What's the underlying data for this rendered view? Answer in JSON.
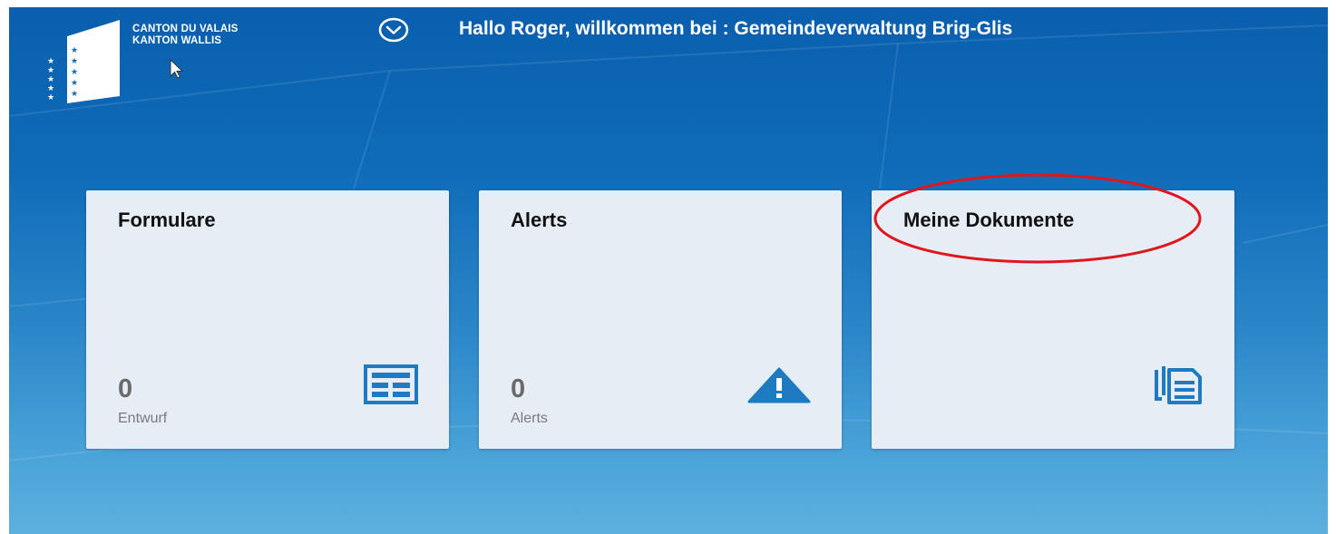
{
  "header": {
    "org_line1": "CANTON DU VALAIS",
    "org_line2": "KANTON WALLIS",
    "greeting": "Hallo Roger, willkommen bei : Gemeindeverwaltung Brig-Glis"
  },
  "tiles": [
    {
      "title": "Formulare",
      "number": "0",
      "unit": "Entwurf",
      "icon": "form-icon"
    },
    {
      "title": "Alerts",
      "number": "0",
      "unit": "Alerts",
      "icon": "warning-icon"
    },
    {
      "title": "Meine Dokumente",
      "number": "",
      "unit": "",
      "icon": "documents-icon"
    }
  ],
  "colors": {
    "background_top": "#0a5fae",
    "background_bottom": "#5cb0de",
    "tile_background": "#e6edf4",
    "icon_accent": "#1f7bc1",
    "highlight_ring": "#e0161c"
  }
}
